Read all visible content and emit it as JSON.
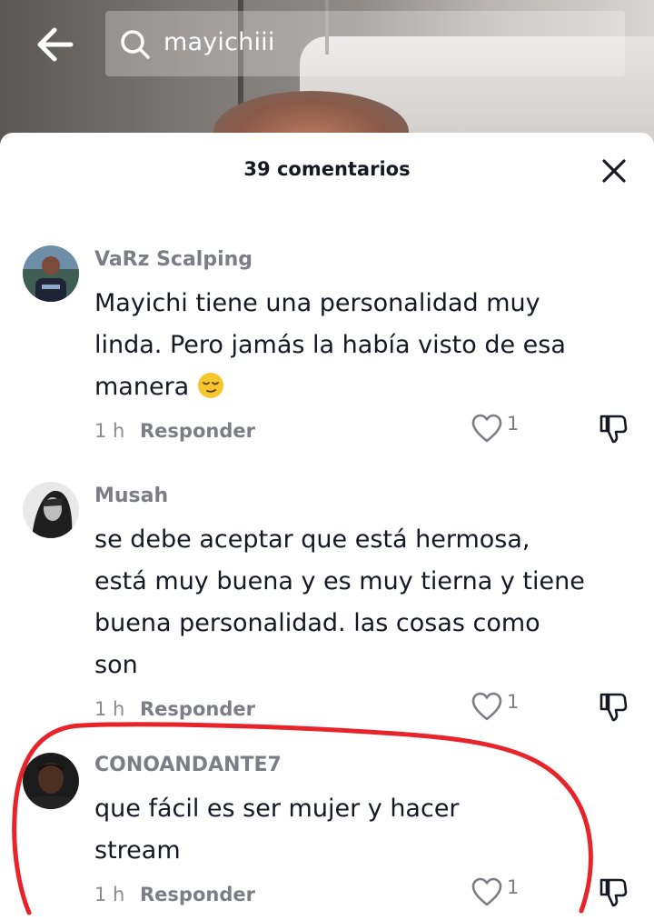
{
  "search": {
    "query": "mayichiii"
  },
  "sheet": {
    "title": "39 comentarios"
  },
  "comments": [
    {
      "username": "VaRz Scalping",
      "text": "Mayichi tiene una personalidad muy linda. Pero jamás la había visto de esa manera",
      "emoji": "relieved-face",
      "time": "1 h",
      "reply_label": "Responder",
      "likes": "1"
    },
    {
      "username": "Musah",
      "text": "se debe aceptar que está hermosa, está muy buena y es muy tierna y tiene buena personalidad. las cosas como son",
      "time": "1 h",
      "reply_label": "Responder",
      "likes": "1"
    },
    {
      "username": "CONOANDANTE7",
      "text": "que fácil es ser mujer y hacer stream",
      "time": "1 h",
      "reply_label": "Responder",
      "likes": "1"
    }
  ],
  "colors": {
    "annotation": "#e8242b",
    "text": "#161823",
    "muted": "#7d7e85"
  },
  "icons": [
    "back-arrow-icon",
    "search-icon",
    "close-icon",
    "heart-icon",
    "dislike-icon"
  ]
}
